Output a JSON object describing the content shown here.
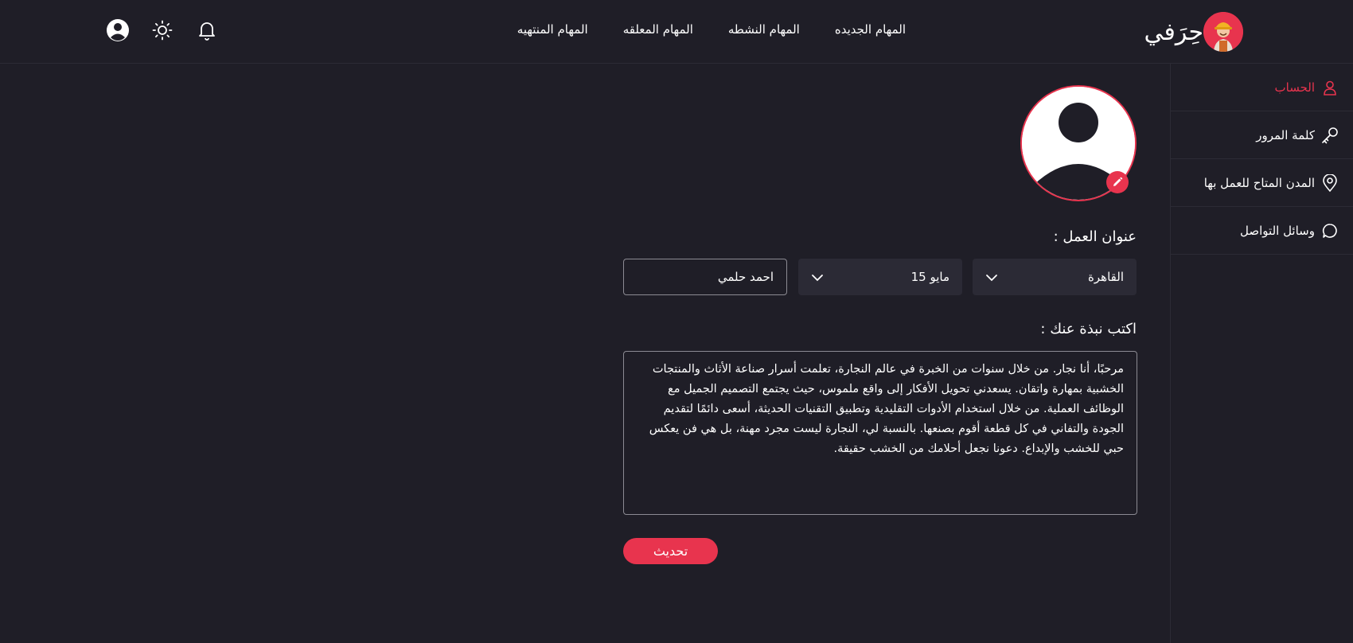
{
  "brand": {
    "name": "حِرَفي",
    "logo_icon": "craftsman-logo"
  },
  "nav": {
    "items": [
      {
        "label": "المهام الجديده"
      },
      {
        "label": "المهام النشطه"
      },
      {
        "label": "المهام المعلقه"
      },
      {
        "label": "المهام المنتهيه"
      }
    ]
  },
  "header_icons": [
    "bell-icon",
    "sun-icon",
    "user-circle-icon"
  ],
  "sidebar": {
    "items": [
      {
        "label": "الحساب",
        "icon": "user-icon",
        "active": true
      },
      {
        "label": "كلمة المرور",
        "icon": "key-icon",
        "active": false
      },
      {
        "label": "المدن المتاح للعمل بها",
        "icon": "location-icon",
        "active": false
      },
      {
        "label": "وسائل التواصل",
        "icon": "chat-icon",
        "active": false
      }
    ]
  },
  "profile": {
    "work_address_label": "عنوان العمل :",
    "city": "القاهرة",
    "district": "15 مايو",
    "name_value": "احمد حلمي",
    "bio_label": "اكتب نبذة عنك :",
    "bio_text": "مرحبًا، أنا نجار. من خلال سنوات من الخبرة في عالم النجارة، تعلمت أسرار صناعة الأثاث والمنتجات الخشبية بمهارة واتقان. يسعدني تحويل الأفكار إلى واقع ملموس، حيث يجتمع التصميم الجميل مع الوظائف العملية. من خلال استخدام الأدوات التقليدية وتطبيق التقنيات الحديثة، أسعى دائمًا لتقديم الجودة والتفاني في كل قطعة أقوم بصنعها. بالنسبة لي، النجارة ليست مجرد مهنة، بل هي فن يعكس حبي للخشب والإبداع. دعونا نجعل أحلامك من الخشب حقيقة.",
    "update_label": "تحديث"
  },
  "colors": {
    "background": "#1f1e27",
    "accent": "#e8344e",
    "field_bg": "#2b2a35"
  }
}
